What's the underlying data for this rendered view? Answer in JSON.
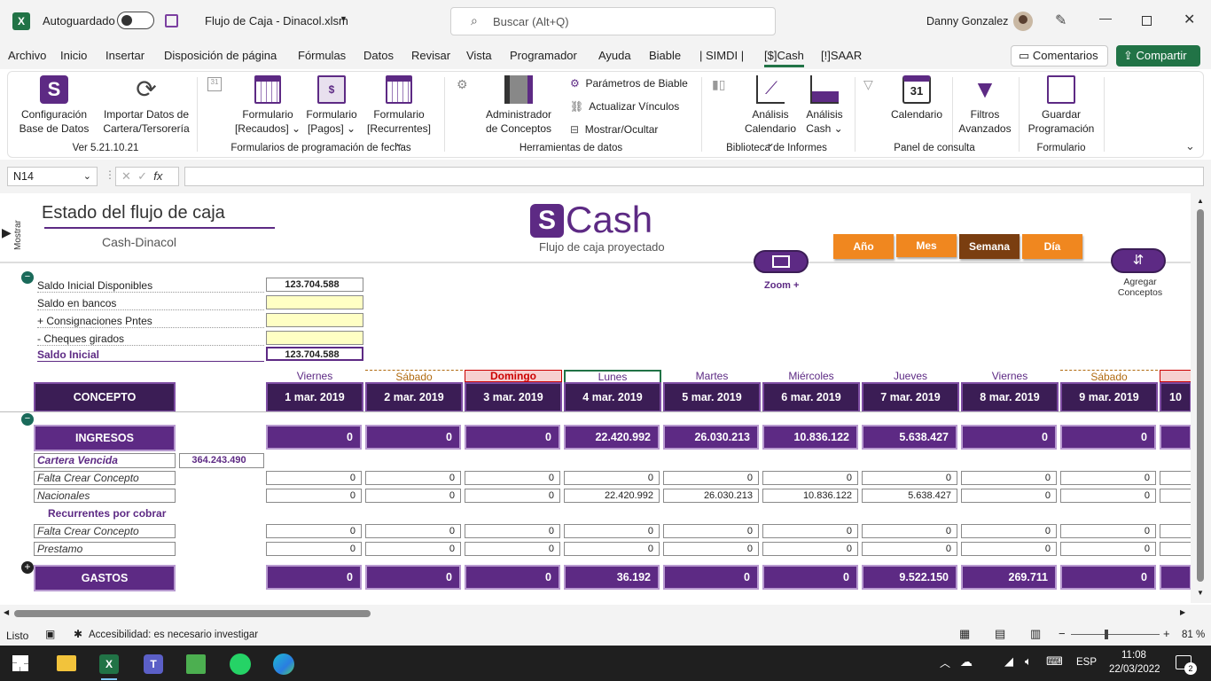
{
  "titlebar": {
    "autosave": "Autoguardado",
    "filename": "Flujo de Caja - Dinacol.xlsm",
    "search_placeholder": "Buscar (Alt+Q)",
    "user": "Danny Gonzalez"
  },
  "tabs": [
    "Archivo",
    "Inicio",
    "Insertar",
    "Disposición de página",
    "Fórmulas",
    "Datos",
    "Revisar",
    "Vista",
    "Programador",
    "Ayuda",
    "Biable",
    "| SIMDI |",
    "[$]Cash",
    "[!]SAAR"
  ],
  "comments_label": "Comentarios",
  "share_label": "Compartir",
  "ribbon": {
    "config_1": "Configuración",
    "config_2": "Base de Datos",
    "import_1": "Importar Datos de",
    "import_2": "Cartera/Tersorería",
    "version": "Ver 5.21.10.21",
    "form_recaudos_1": "Formulario",
    "form_recaudos_2": "[Recaudos]",
    "form_pagos_1": "Formulario",
    "form_pagos_2": "[Pagos]",
    "form_recurrentes_1": "Formulario",
    "form_recurrentes_2": "[Recurrentes]",
    "group_forms": "Formularios de programación de fechas",
    "admin_1": "Administrador",
    "admin_2": "de Conceptos",
    "param_biable": "Parámetros de Biable",
    "update_links": "Actualizar Vínculos",
    "show_hide": "Mostrar/Ocultar",
    "group_tools": "Herramientas de datos",
    "analysis_cal_1": "Análisis",
    "analysis_cal_2": "Calendario",
    "analysis_cash_1": "Análisis",
    "analysis_cash_2": "Cash",
    "group_reports": "Biblioteca de Informes",
    "calendar": "Calendario",
    "filters_1": "Filtros",
    "filters_2": "Avanzados",
    "group_panel": "Panel de consulta",
    "save_1": "Guardar",
    "save_2": "Programación",
    "group_form": "Formulario"
  },
  "formula_bar": {
    "namebox": "N14",
    "formula": ""
  },
  "sheet": {
    "show_label": "Mostrar",
    "title": "Estado del flujo de caja",
    "subtitle": "Cash-Dinacol",
    "logo_text": "Cash",
    "logo_sub": "Flujo de caja proyectado",
    "zoom_label": "Zoom +",
    "add_concepts_1": "Agregar",
    "add_concepts_2": "Conceptos",
    "period_buttons": [
      "Año",
      "Mes",
      "Semana",
      "Día"
    ],
    "summary": [
      {
        "label": "Saldo Inicial Disponibles",
        "value": "123.704.588"
      },
      {
        "label": "Saldo en bancos",
        "value": ""
      },
      {
        "label": "+ Consignaciones Pntes",
        "value": ""
      },
      {
        "label": "- Cheques girados",
        "value": ""
      },
      {
        "label": "Saldo Inicial",
        "value": "123.704.588"
      }
    ],
    "concept_header": "CONCEPTO",
    "days": [
      "Viernes",
      "Sábado",
      "Domingo",
      "Lunes",
      "Martes",
      "Miércoles",
      "Jueves",
      "Viernes",
      "Sábado",
      "D"
    ],
    "dates": [
      "1 mar. 2019",
      "2 mar. 2019",
      "3 mar. 2019",
      "4 mar. 2019",
      "5 mar. 2019",
      "6 mar. 2019",
      "7 mar. 2019",
      "8 mar. 2019",
      "9 mar. 2019",
      "10"
    ],
    "ingresos_label": "INGRESOS",
    "ingresos": [
      "0",
      "0",
      "0",
      "22.420.992",
      "26.030.213",
      "10.836.122",
      "5.638.427",
      "0",
      "0"
    ],
    "cartera_label": "Cartera Vencida",
    "cartera_value": "364.243.490",
    "rows": [
      {
        "label": "Falta Crear Concepto",
        "values": [
          "0",
          "0",
          "0",
          "0",
          "0",
          "0",
          "0",
          "0",
          "0"
        ]
      },
      {
        "label": "Nacionales",
        "values": [
          "0",
          "0",
          "0",
          "22.420.992",
          "26.030.213",
          "10.836.122",
          "5.638.427",
          "0",
          "0"
        ]
      }
    ],
    "recurrentes_label": "Recurrentes por cobrar",
    "rows2": [
      {
        "label": "Falta Crear Concepto",
        "values": [
          "0",
          "0",
          "0",
          "0",
          "0",
          "0",
          "0",
          "0",
          "0"
        ]
      },
      {
        "label": "Prestamo",
        "values": [
          "0",
          "0",
          "0",
          "0",
          "0",
          "0",
          "0",
          "0",
          "0"
        ]
      }
    ],
    "gastos_label": "GASTOS",
    "gastos": [
      "0",
      "0",
      "0",
      "36.192",
      "0",
      "0",
      "9.522.150",
      "269.711",
      "0"
    ]
  },
  "status": {
    "ready": "Listo",
    "accessibility": "Accesibilidad: es necesario investigar",
    "zoom": "81 %"
  },
  "taskbar": {
    "lang": "ESP",
    "time": "11:08",
    "date": "22/03/2022",
    "notif": "2"
  },
  "colors": {
    "purple": "#5d2a84",
    "dark": "#3b1d55",
    "excel_green": "#217346",
    "orange": "#f0871f"
  }
}
